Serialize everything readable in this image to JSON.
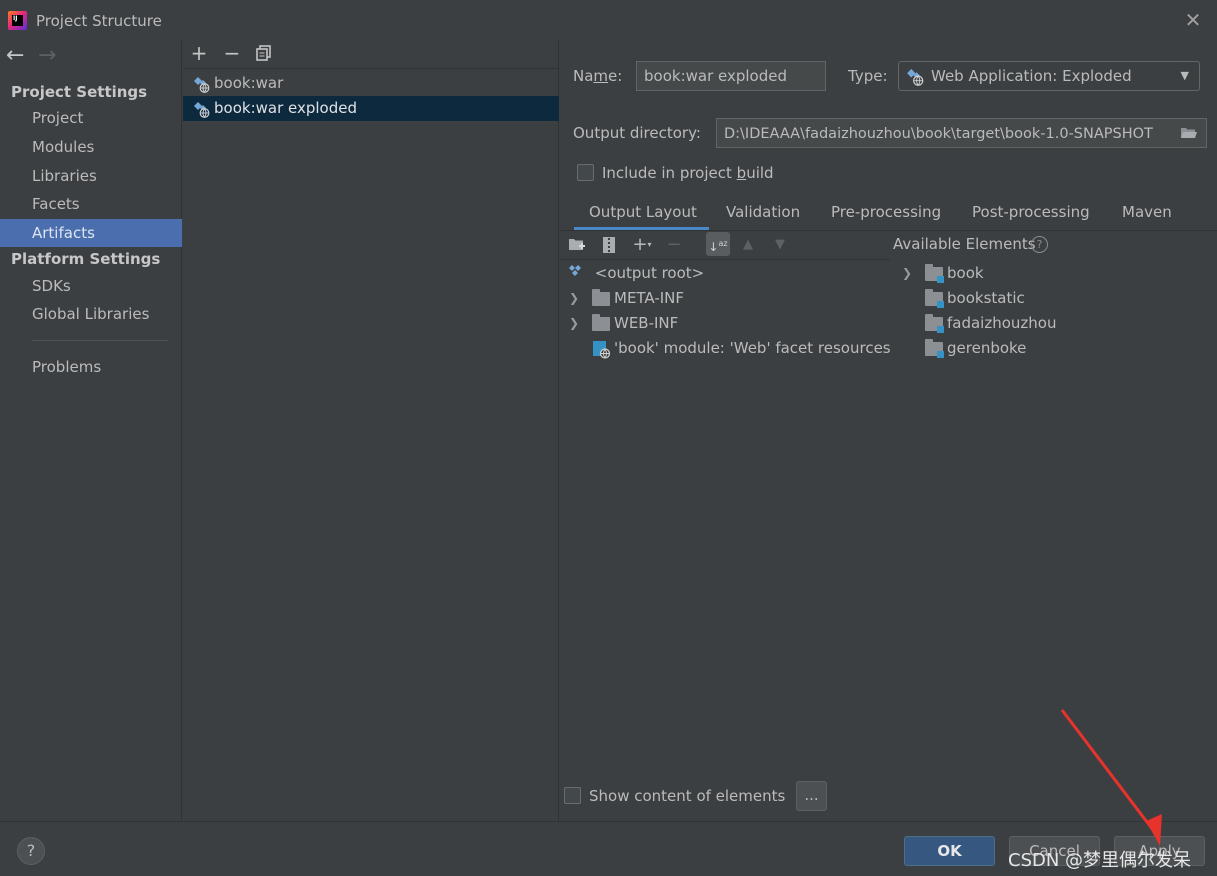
{
  "window": {
    "title": "Project Structure"
  },
  "nav": {
    "project_settings_header": "Project Settings",
    "project_items": [
      "Project",
      "Modules",
      "Libraries",
      "Facets",
      "Artifacts"
    ],
    "platform_settings_header": "Platform Settings",
    "platform_items": [
      "SDKs",
      "Global Libraries"
    ],
    "problems": "Problems",
    "selected": "Artifacts"
  },
  "artifacts": {
    "items": [
      "book:war",
      "book:war exploded"
    ],
    "selected": "book:war exploded"
  },
  "form": {
    "name_label_prefix": "Na",
    "name_label_mnemonic": "m",
    "name_label_suffix": "e:",
    "name_value": "book:war exploded",
    "type_label": "Type:",
    "type_value": "Web Application: Exploded",
    "output_dir_label": "Output directory:",
    "output_dir_value": "D:\\IDEAAA\\fadaizhouzhou\\book\\target\\book-1.0-SNAPSHOT",
    "include_label_prefix": "Include in project ",
    "include_label_mnemonic": "b",
    "include_label_suffix": "uild",
    "include_checked": false
  },
  "tabs": [
    "Output Layout",
    "Validation",
    "Pre-processing",
    "Post-processing",
    "Maven"
  ],
  "active_tab": "Output Layout",
  "output_tree": {
    "root": "<output root>",
    "children": [
      "META-INF",
      "WEB-INF",
      "'book' module: 'Web' facet resources"
    ]
  },
  "available": {
    "title": "Available Elements",
    "items": [
      "book",
      "bookstatic",
      "fadaizhouzhou",
      "gerenboke"
    ]
  },
  "show_content_label": "Show content of elements",
  "show_content_checked": false,
  "dots_label": "...",
  "buttons": {
    "ok": "OK",
    "cancel": "Cancel",
    "apply": "Apply"
  },
  "help_label": "?",
  "watermark": "CSDN @梦里偶尔发呆"
}
